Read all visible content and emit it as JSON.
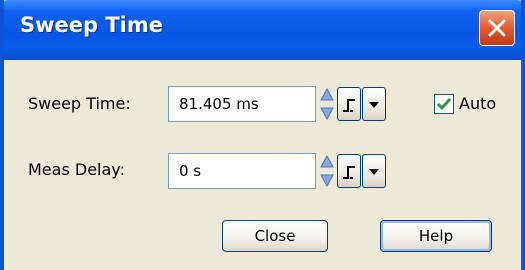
{
  "window": {
    "title": "Sweep Time"
  },
  "sweep_time": {
    "label": "Sweep Time:",
    "value": "81.405 ms"
  },
  "auto": {
    "label": "Auto",
    "checked": true
  },
  "meas_delay": {
    "label": "Meas Delay:",
    "value": "0 s"
  },
  "buttons": {
    "close": "Close",
    "help": "Help"
  },
  "colors": {
    "titlebar": "#0757e6",
    "close_button": "#e2542c",
    "check": "#2a9b3c",
    "border": "#0a55d8"
  }
}
